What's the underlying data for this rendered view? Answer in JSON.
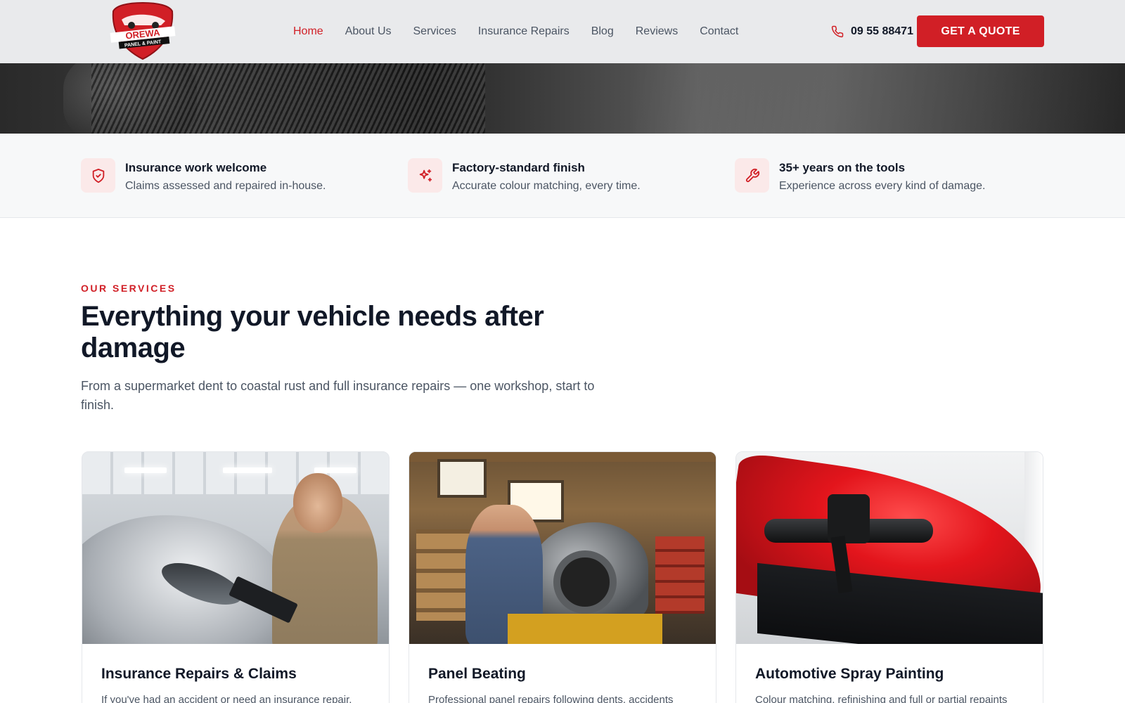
{
  "brand": {
    "logo_top_text": "OREWA",
    "logo_bottom_text": "PANEL & PAINT",
    "logo_color": "#d11f26"
  },
  "nav": {
    "items": [
      {
        "label": "Home",
        "active": true
      },
      {
        "label": "About Us",
        "active": false
      },
      {
        "label": "Services",
        "active": false
      },
      {
        "label": "Insurance Repairs",
        "active": false
      },
      {
        "label": "Blog",
        "active": false
      },
      {
        "label": "Reviews",
        "active": false
      },
      {
        "label": "Contact",
        "active": false
      }
    ],
    "active_color": "#d11f26"
  },
  "header": {
    "phone_icon": "phone-icon",
    "phone_number": "09 55 88471",
    "quote_button": "GET A QUOTE",
    "accent": "#d11f26"
  },
  "features": [
    {
      "icon": "shield-check-icon",
      "title": "Insurance work welcome",
      "desc": "Claims assessed and repaired in-house."
    },
    {
      "icon": "sparkles-icon",
      "title": "Factory-standard finish",
      "desc": "Accurate colour matching, every time."
    },
    {
      "icon": "wrench-icon",
      "title": "35+ years on the tools",
      "desc": "Experience across every kind of damage."
    }
  ],
  "services": {
    "eyebrow": "OUR SERVICES",
    "heading": "Everything your vehicle needs after damage",
    "lead": "From a supermarket dent to coastal rust and full insurance repairs — one workshop, start to finish.",
    "cards": [
      {
        "title": "Insurance Repairs & Claims",
        "desc": "If you've had an accident or need an insurance repair,"
      },
      {
        "title": "Panel Beating",
        "desc": "Professional panel repairs following dents, accidents"
      },
      {
        "title": "Automotive Spray Painting",
        "desc": "Colour matching, refinishing and full or partial repaints"
      }
    ]
  }
}
